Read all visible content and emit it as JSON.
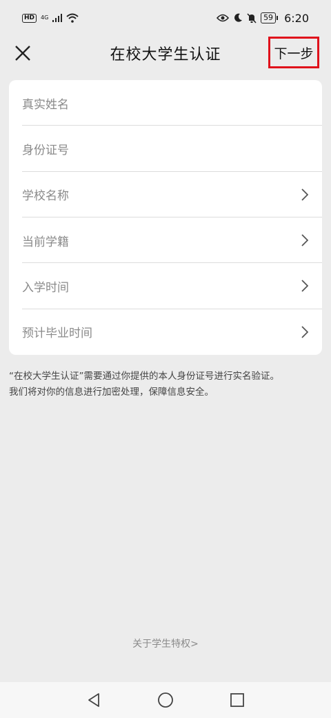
{
  "status_bar": {
    "hd": "HD",
    "network": "4G",
    "battery": "59",
    "time": "6:20"
  },
  "header": {
    "title": "在校大学生认证",
    "next_label": "下一步"
  },
  "form": {
    "fields": [
      {
        "label": "真实姓名",
        "has_arrow": false
      },
      {
        "label": "身份证号",
        "has_arrow": false
      },
      {
        "label": "学校名称",
        "has_arrow": true
      },
      {
        "label": "当前学籍",
        "has_arrow": true
      },
      {
        "label": "入学时间",
        "has_arrow": true
      },
      {
        "label": "预计毕业时间",
        "has_arrow": true
      }
    ]
  },
  "notice": {
    "line1": "“在校大学生认证”需要通过你提供的本人身份证号进行实名验证。",
    "line2": "我们将对你的信息进行加密处理，保障信息安全。"
  },
  "footer": {
    "privilege_link": "关于学生特权>"
  },
  "icons": {
    "close": "close-icon",
    "chevron": "chevron-right-icon",
    "back": "back-triangle-icon",
    "home": "home-circle-icon",
    "recents": "recents-square-icon"
  }
}
